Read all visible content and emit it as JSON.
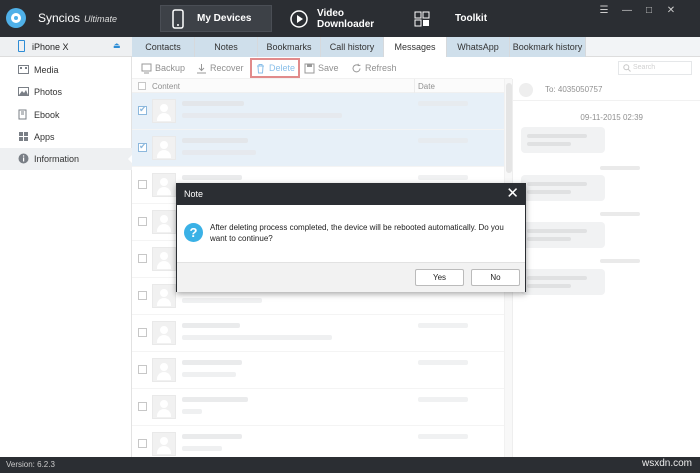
{
  "app": {
    "name": "Syncios",
    "edition": "Ultimate"
  },
  "topnav": {
    "my_devices": "My Devices",
    "video_downloader": "Video Downloader",
    "toolkit": "Toolkit"
  },
  "window": {
    "menu": "☰",
    "minimize": "—",
    "maximize": "□",
    "close": "✕"
  },
  "device": {
    "name": "iPhone X"
  },
  "sidebar": {
    "items": [
      {
        "label": "Media",
        "icon": "film-icon"
      },
      {
        "label": "Photos",
        "icon": "photo-icon"
      },
      {
        "label": "Ebook",
        "icon": "book-icon"
      },
      {
        "label": "Apps",
        "icon": "apps-icon"
      },
      {
        "label": "Information",
        "icon": "info-icon",
        "active": true
      }
    ]
  },
  "tabs": [
    "Contacts",
    "Notes",
    "Bookmarks",
    "Call history",
    "Messages",
    "WhatsApp",
    "Bookmark history"
  ],
  "active_tab": "Messages",
  "toolbar": {
    "backup": "Backup",
    "recover": "Recover",
    "delete": "Delete",
    "save": "Save",
    "refresh": "Refresh"
  },
  "search": {
    "placeholder": "Search"
  },
  "list": {
    "col_content": "Content",
    "col_date": "Date"
  },
  "conversation": {
    "to": "To: 4035050757",
    "first_timestamp": "09-11-2015 02:39"
  },
  "dialog": {
    "title": "Note",
    "close": "✕",
    "message": "After deleting process completed, the device will be rebooted automatically. Do you want to continue?",
    "yes": "Yes",
    "no": "No"
  },
  "status": {
    "version": "Version: 6.2.3",
    "watermark": "wsxdn.com"
  },
  "colors": {
    "titlebar": "#2b2e33",
    "accent": "#2a8bd8",
    "highlight": "#c82c2c",
    "selected_row": "#d4e4f2"
  }
}
